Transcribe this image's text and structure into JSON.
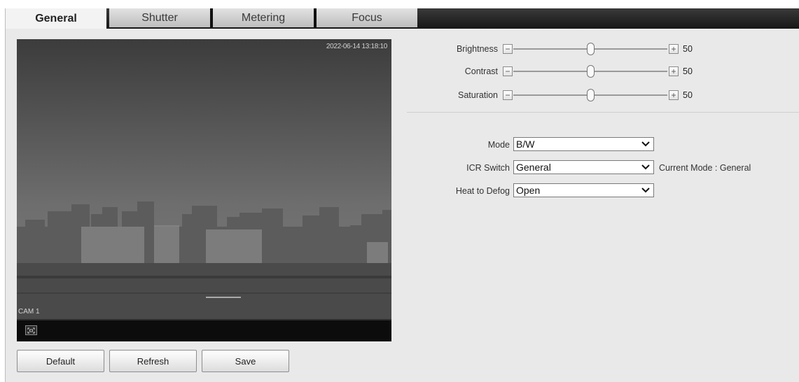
{
  "tabs": [
    {
      "label": "General",
      "active": true
    },
    {
      "label": "Shutter",
      "active": false
    },
    {
      "label": "Metering",
      "active": false
    },
    {
      "label": "Focus",
      "active": false
    }
  ],
  "video": {
    "timestamp": "2022-06-14 13:18:10",
    "channel_label": "CAM 1",
    "fit_icon": "fit-screen-icon"
  },
  "buttons": {
    "default": "Default",
    "refresh": "Refresh",
    "save": "Save"
  },
  "sliders": [
    {
      "label": "Brightness",
      "value": "50",
      "level": 50
    },
    {
      "label": "Contrast",
      "value": "50",
      "level": 50
    },
    {
      "label": "Saturation",
      "value": "50",
      "level": 50
    }
  ],
  "controls": {
    "minus_symbol": "−",
    "plus_symbol": "+"
  },
  "form": {
    "mode": {
      "label": "Mode",
      "value": "B/W"
    },
    "icr_switch": {
      "label": "ICR Switch",
      "value": "General",
      "note": "Current Mode : General"
    },
    "heat_to_defog": {
      "label": "Heat to Defog",
      "value": "Open"
    }
  },
  "colors": {
    "tabbar": "#1c1c1c",
    "panel": "#e9e9e9",
    "video_bg": "#2a2a2a"
  }
}
